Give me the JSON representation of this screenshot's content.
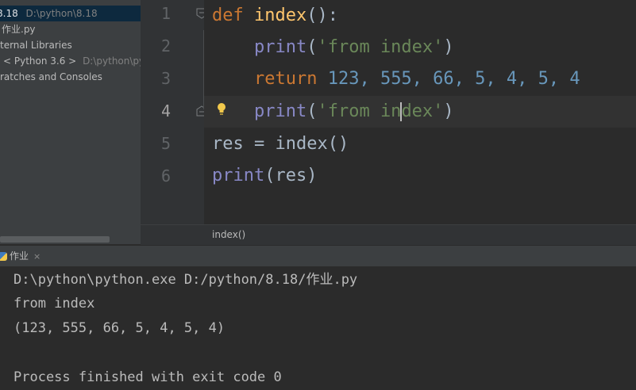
{
  "project": {
    "root_name": "8.18",
    "root_path": "D:\\python\\8.18",
    "file_name": "作业.py",
    "external_libraries": "ternal Libraries",
    "python_sdk": "< Python 3.6 >",
    "python_sdk_path": "D:\\python\\pyth",
    "scratches": "ratches and Consoles"
  },
  "editor": {
    "line_numbers": [
      "1",
      "2",
      "3",
      "4",
      "5",
      "6"
    ],
    "line1": {
      "kw": "def",
      "fn": "index",
      "rest": "():"
    },
    "line2": {
      "indent": "    ",
      "builtin": "print",
      "open": "(",
      "str": "'from index'",
      "close": ")"
    },
    "line3": {
      "indent": "    ",
      "kw": "return",
      "nums": "123, 555, 66, 5, 4, 5, 4"
    },
    "line4": {
      "indent": "    ",
      "builtin": "print",
      "open": "(",
      "str_a": "'from in",
      "str_b": "dex'",
      "close": ")"
    },
    "line5": {
      "text": "res = index()"
    },
    "line6": {
      "builtin": "print",
      "rest": "(res)"
    }
  },
  "breadcrumb": "index()",
  "run": {
    "tab_label": "作业",
    "tab_close": "×",
    "lines": [
      "D:\\python\\python.exe D:/python/8.18/作业.py",
      "from index",
      "(123, 555, 66, 5, 4, 5, 4)",
      "",
      "Process finished with exit code 0"
    ]
  },
  "colors": {
    "keyword": "#cc7832",
    "function": "#ffc66d",
    "builtin": "#8888c6",
    "string": "#6a8759",
    "number": "#6897bb"
  },
  "icons": [
    "fold-icon",
    "lightbulb-icon",
    "python-file-icon",
    "close-icon"
  ]
}
